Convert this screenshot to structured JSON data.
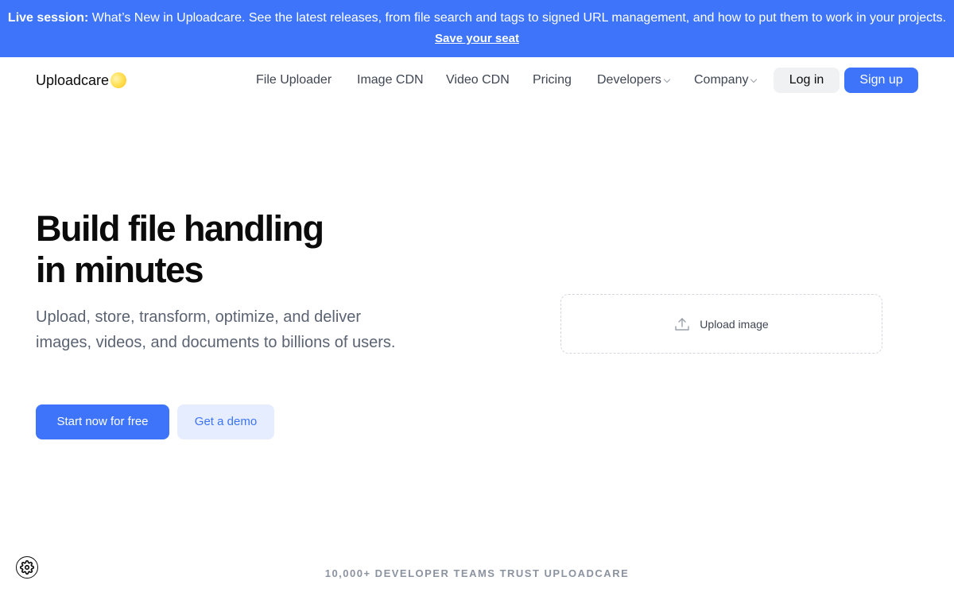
{
  "banner": {
    "bold": "Live session:",
    "text": " What’s New in Uploadcare. See the latest releases, from file search and tags to signed URL management, and how to put them to work in your projects.",
    "link": "Save your seat",
    "background": "#3d74fa"
  },
  "header": {
    "logo_text": "Uploadcare",
    "nav": [
      {
        "label": "File Uploader",
        "dropdown": false
      },
      {
        "label": "Image CDN",
        "dropdown": false
      },
      {
        "label": "Video CDN",
        "dropdown": false
      },
      {
        "label": "Pricing",
        "dropdown": false
      },
      {
        "label": "Developers",
        "dropdown": true
      },
      {
        "label": "Company",
        "dropdown": true
      }
    ],
    "login_label": "Log in",
    "signup_label": "Sign up"
  },
  "hero": {
    "title_line1": "Build file handling",
    "title_line2": "in minutes",
    "subtitle": "Upload, store, transform, optimize, and deliver images, videos, and documents to billions of users.",
    "primary_cta": "Start now for free",
    "secondary_cta": "Get a demo"
  },
  "uploader": {
    "label": "Upload image",
    "icon": "upload-icon"
  },
  "trust_line": "10,000+ DEVELOPER TEAMS TRUST UPLOADCARE",
  "settings_icon": "gear-icon",
  "colors": {
    "accent": "#3d74fa",
    "accent_soft": "#e6edfe",
    "text_dark": "#0b0b0c",
    "text_muted": "#5b6372"
  }
}
